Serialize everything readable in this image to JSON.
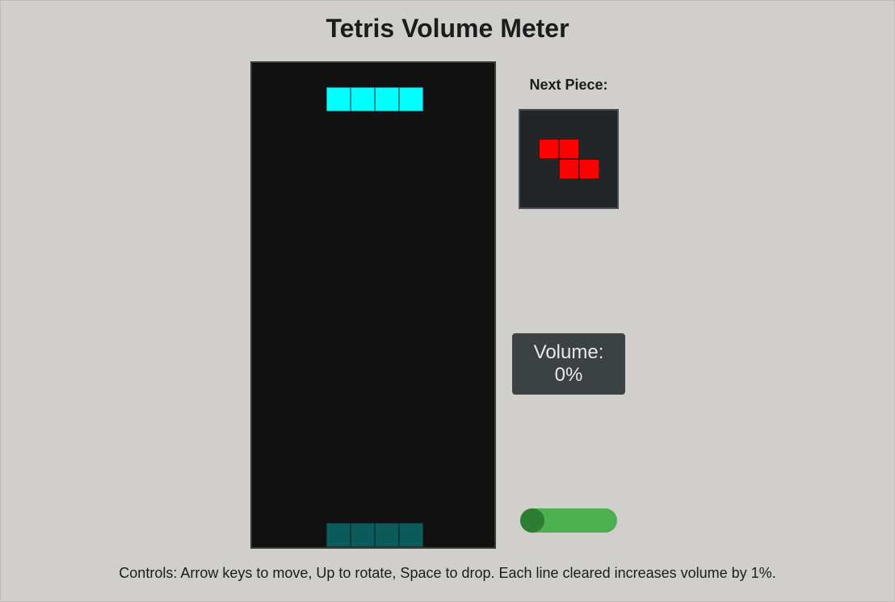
{
  "page": {
    "title": "Tetris Volume Meter",
    "controls_text": "Controls: Arrow keys to move, Up to rotate, Space to drop. Each line cleared increases volume by 1%."
  },
  "board": {
    "columns": 10,
    "rows": 20,
    "active_piece": {
      "type": "I",
      "color": "#00ffff",
      "cells": [
        [
          3,
          1
        ],
        [
          4,
          1
        ],
        [
          5,
          1
        ],
        [
          6,
          1
        ]
      ]
    },
    "ghost_piece": {
      "color": "#0d5a5a",
      "cells": [
        [
          3,
          19
        ],
        [
          4,
          19
        ],
        [
          5,
          19
        ],
        [
          6,
          19
        ]
      ]
    }
  },
  "next_piece": {
    "label": "Next Piece:",
    "type": "Z",
    "color": "#ff0000",
    "cells": [
      [
        0,
        0
      ],
      [
        1,
        0
      ],
      [
        1,
        1
      ],
      [
        2,
        1
      ]
    ]
  },
  "volume": {
    "label": "Volume:",
    "value_text": "0%",
    "level": 0
  },
  "toggle": {
    "on": true,
    "color": "#4caf50"
  }
}
